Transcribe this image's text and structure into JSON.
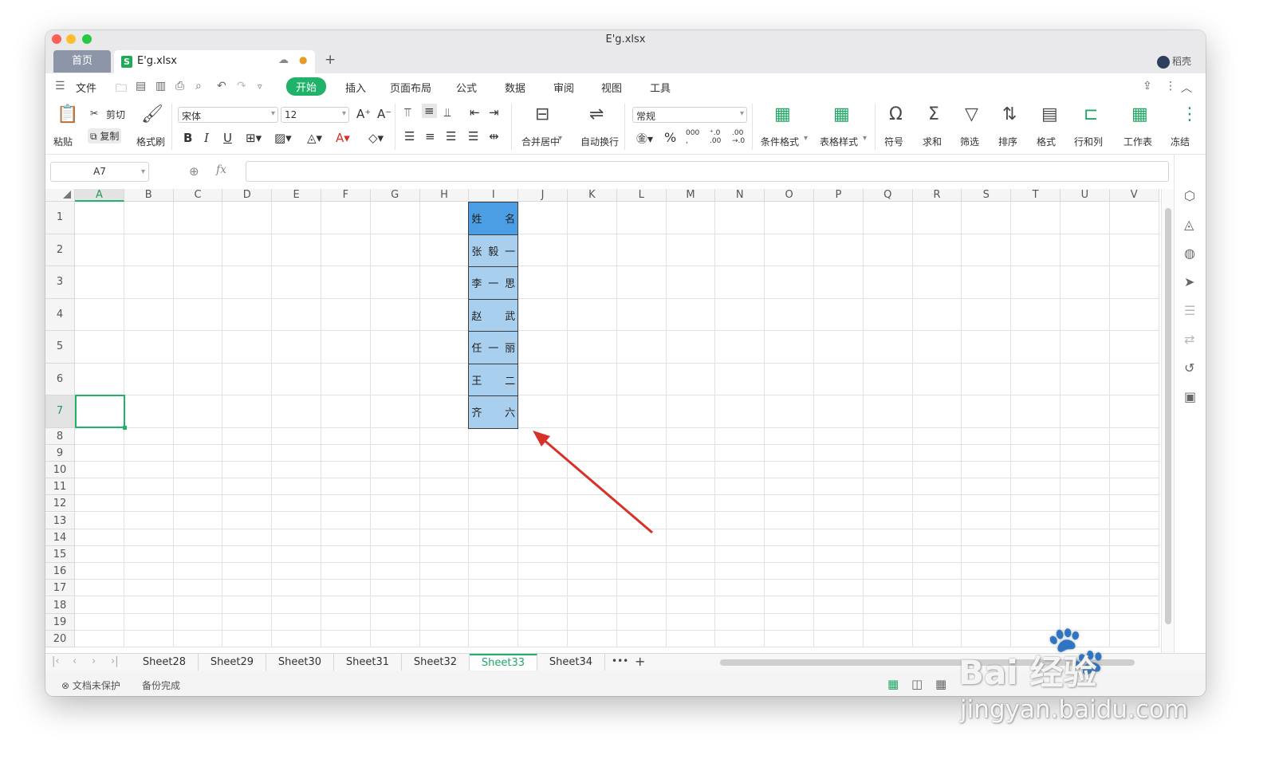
{
  "window": {
    "title": "E'g.xlsx"
  },
  "tabs": {
    "home": "首页",
    "file": "E'g.xlsx",
    "file_icon": "S",
    "user": "稻壳"
  },
  "menu": {
    "items": [
      "文件",
      "开始",
      "插入",
      "页面布局",
      "公式",
      "数据",
      "审阅",
      "视图",
      "工具"
    ],
    "active": "开始"
  },
  "ribbon": {
    "paste": "粘贴",
    "cut": "剪切",
    "copy": "复制",
    "format_painter": "格式刷",
    "font_name": "宋体",
    "font_size": "12",
    "merge": "合并居中",
    "wrap": "自动换行",
    "number_format": "常规",
    "cond_format": "条件格式",
    "table_style": "表格样式",
    "symbol": "符号",
    "sum": "求和",
    "filter": "筛选",
    "sort": "排序",
    "format": "格式",
    "rows_cols": "行和列",
    "worksheet": "工作表",
    "freeze": "冻结"
  },
  "formula": {
    "name_box": "A7",
    "fx": "fx",
    "value": ""
  },
  "grid": {
    "columns": [
      "A",
      "B",
      "C",
      "D",
      "E",
      "F",
      "G",
      "H",
      "I",
      "J",
      "K",
      "L",
      "M",
      "N",
      "O",
      "P",
      "Q",
      "R",
      "S",
      "T",
      "U",
      "V"
    ],
    "rows": [
      "1",
      "2",
      "3",
      "4",
      "5",
      "6",
      "7",
      "8",
      "9",
      "10",
      "11",
      "12",
      "13",
      "14",
      "15",
      "16",
      "17",
      "18",
      "19",
      "20"
    ],
    "selected_cell": "A7",
    "name_column": "I",
    "names": [
      [
        "姓",
        "名"
      ],
      [
        "张",
        "毅",
        "一"
      ],
      [
        "李",
        "一",
        "思"
      ],
      [
        "赵",
        "武"
      ],
      [
        "任",
        "一",
        "丽"
      ],
      [
        "王",
        "二"
      ],
      [
        "齐",
        "六"
      ]
    ]
  },
  "sheets": {
    "items": [
      "Sheet28",
      "Sheet29",
      "Sheet30",
      "Sheet31",
      "Sheet32",
      "Sheet33",
      "Sheet34"
    ],
    "active": "Sheet33",
    "more": "•••",
    "add": "+"
  },
  "status": {
    "protect": "文档未保护",
    "backup": "备份完成"
  },
  "watermark": {
    "brand": "Bai  经验",
    "url": "jingyan.baidu.com"
  },
  "colors": {
    "accent": "#1fb36a",
    "header_fill": "#4b9ee3",
    "name_fill": "#a9cfee",
    "arrow": "#d8312a"
  }
}
